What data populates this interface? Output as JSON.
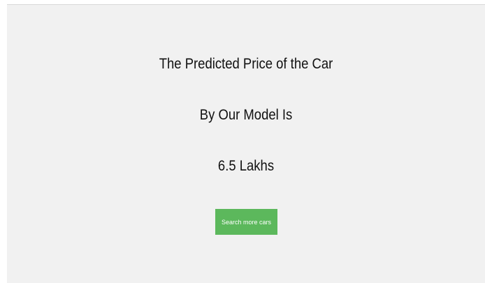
{
  "result": {
    "line1": "The Predicted Price of the Car",
    "line2": "By Our Model Is",
    "price": "6.5 Lakhs"
  },
  "actions": {
    "search_more_label": "Search more cars"
  },
  "colors": {
    "page_background": "#f1f1f1",
    "button_background": "#5cb85c",
    "button_text": "#ffffff",
    "text": "#111111"
  }
}
